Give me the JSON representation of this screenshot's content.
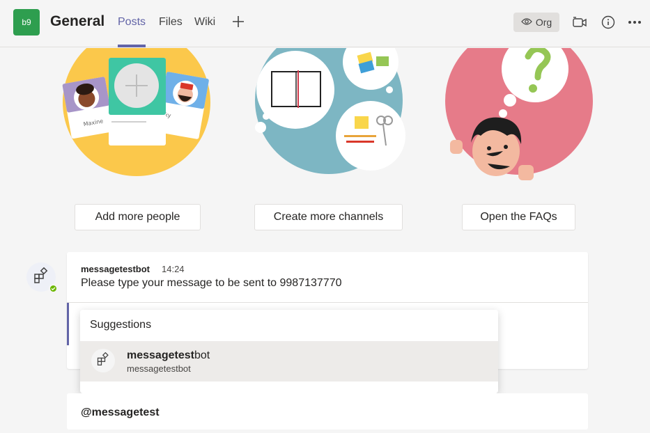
{
  "header": {
    "team_avatar": "b9",
    "channel_title": "General",
    "tabs": [
      {
        "label": "Posts",
        "active": true
      },
      {
        "label": "Files",
        "active": false
      },
      {
        "label": "Wiki",
        "active": false
      }
    ],
    "org_label": "Org",
    "icons": [
      "add-tab-icon",
      "eye-icon",
      "meet-video-icon",
      "info-icon",
      "more-options-icon"
    ]
  },
  "actions": {
    "add_people": "Add more people",
    "create_channels": "Create more channels",
    "open_faqs": "Open the FAQs"
  },
  "illustrations": {
    "people_cards": [
      "Maxine",
      "ky"
    ]
  },
  "message": {
    "sender": "messagetestbot",
    "time": "14:24",
    "text": "Please type your message to be sent to 9987137770"
  },
  "suggestions": {
    "title": "Suggestions",
    "items": [
      {
        "name_match": "messagetest",
        "name_rest": "bot",
        "subtitle": "messagetestbot"
      }
    ]
  },
  "compose": {
    "text": "@messagetest"
  },
  "colors": {
    "accent": "#6264a7",
    "team_avatar": "#2e9e4f",
    "presence_available": "#6bb700"
  }
}
